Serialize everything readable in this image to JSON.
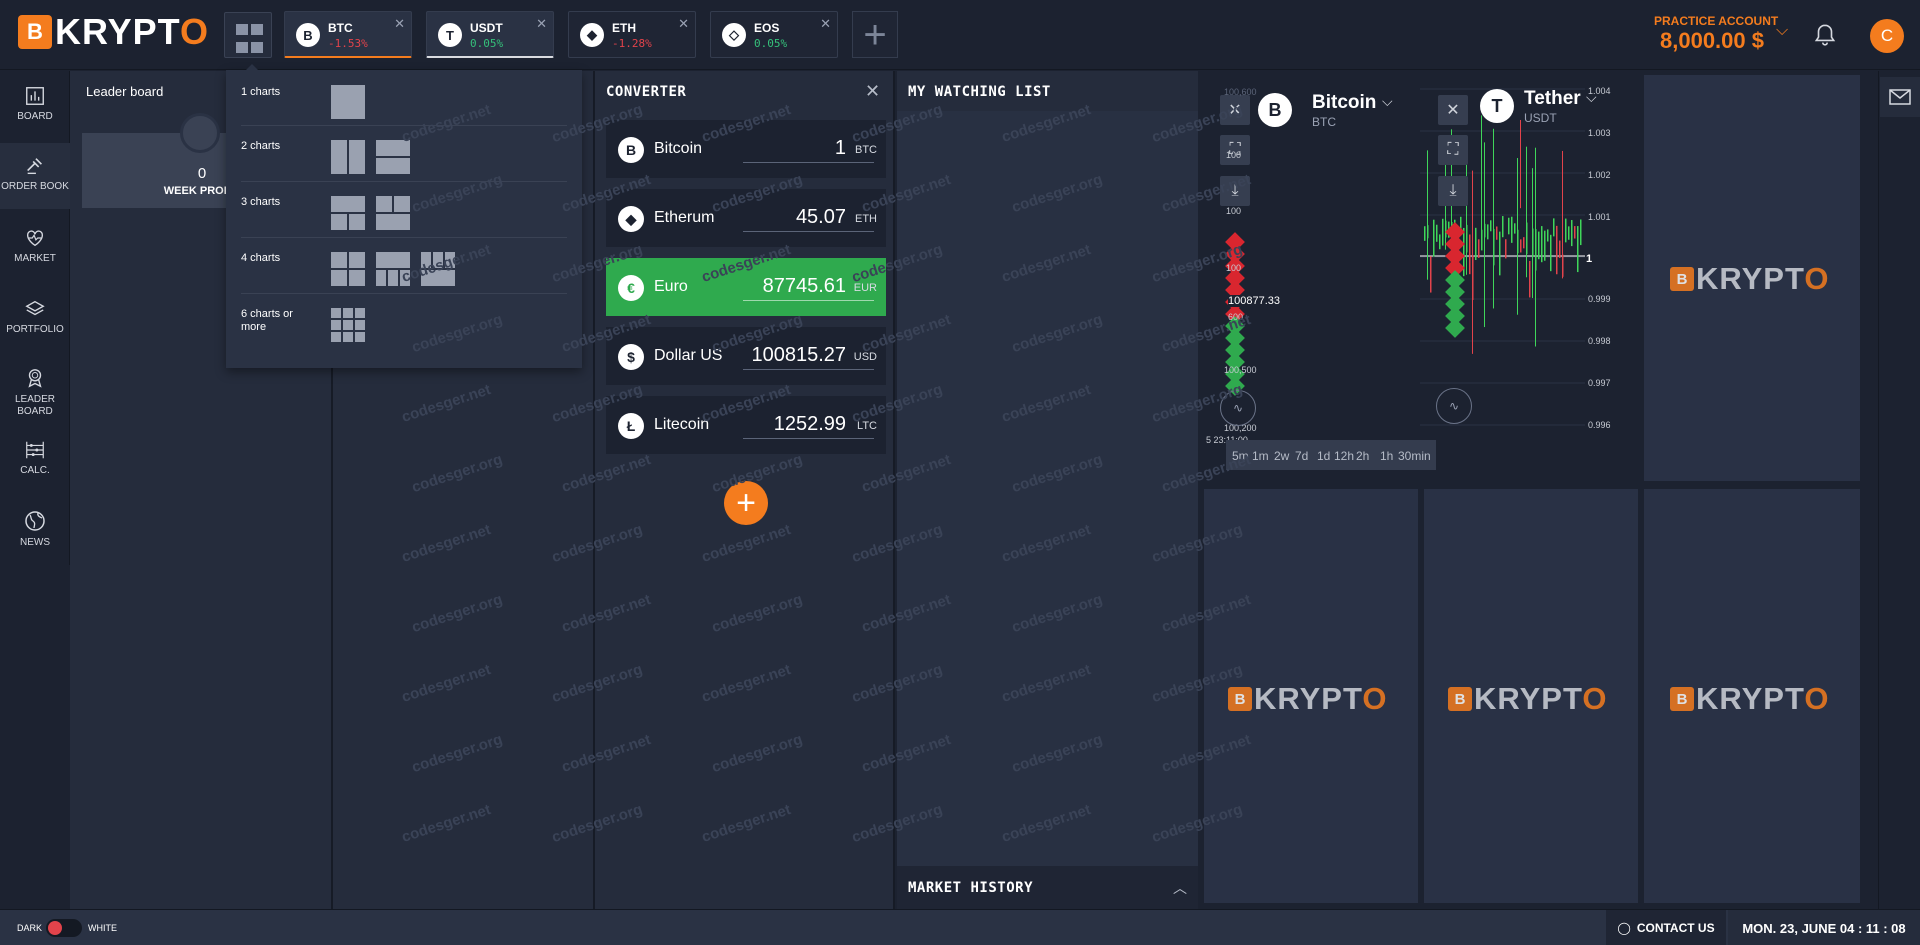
{
  "app": {
    "brand_initial": "B",
    "brand_name_main": "KRYPT",
    "brand_name_o": "O"
  },
  "tabs": [
    {
      "name": "BTC",
      "change": "-1.53%",
      "icon": "B",
      "trend": "neg"
    },
    {
      "name": "USDT",
      "change": "0.05%",
      "icon": "T",
      "trend": "pos"
    },
    {
      "name": "ETH",
      "change": "-1.28%",
      "icon": "◆",
      "trend": "neg"
    },
    {
      "name": "EOS",
      "change": "0.05%",
      "icon": "◇",
      "trend": "pos"
    }
  ],
  "account": {
    "label": "PRACTICE ACCOUNT",
    "balance": "8,000.00 $",
    "avatar": "C"
  },
  "sidebar": [
    {
      "label": "BOARD",
      "icon": "bar-chart-icon"
    },
    {
      "label": "ORDER BOOK",
      "icon": "gavel-icon"
    },
    {
      "label": "MARKET",
      "icon": "heart-pulse-icon"
    },
    {
      "label": "PORTFOLIO",
      "icon": "layers-icon"
    },
    {
      "label": "LEADER\nBOARD",
      "icon": "award-icon"
    },
    {
      "label": "CALC.",
      "icon": "abacus-icon"
    },
    {
      "label": "NEWS",
      "icon": "globe-icon"
    }
  ],
  "leaderboard": {
    "title": "Leader board",
    "value": "0",
    "label": "WEEK PROFIT"
  },
  "layout_menu": {
    "rows": [
      {
        "label": "1 charts"
      },
      {
        "label": "2 charts"
      },
      {
        "label": "3 charts"
      },
      {
        "label": "4 charts"
      },
      {
        "label": "6 charts or more"
      }
    ]
  },
  "converter": {
    "title": "CONVERTER",
    "rows": [
      {
        "name": "Bitcoin",
        "amount": "1",
        "currency": "BTC",
        "icon": "B"
      },
      {
        "name": "Etherum",
        "amount": "45.07",
        "currency": "ETH",
        "icon": "◆"
      },
      {
        "name": "Euro",
        "amount": "87745.61",
        "currency": "EUR",
        "icon": "€"
      },
      {
        "name": "Dollar US",
        "amount": "100815.27",
        "currency": "USD",
        "icon": "$"
      },
      {
        "name": "Litecoin",
        "amount": "1252.99",
        "currency": "LTC",
        "icon": "Ł"
      }
    ]
  },
  "watchlist": {
    "title": "MY WATCHING LIST",
    "market_history": "MARKET HISTORY"
  },
  "charts": {
    "bitcoin": {
      "name": "Bitcoin",
      "symbol": "BTC",
      "icon": "B",
      "price_label": "100877.33",
      "ticks": [
        "100,500",
        "100,200"
      ],
      "tick_partial": [
        "100,600",
        "100",
        "100",
        "600"
      ],
      "time": "5 23:11:00"
    },
    "tether": {
      "name": "Tether",
      "symbol": "USDT",
      "icon": "T",
      "ticks": [
        "1.004",
        "1.003",
        "1.002",
        "1.001",
        "1",
        "0.999",
        "0.998",
        "0.997",
        "0.996"
      ]
    },
    "timeframes": [
      "5m",
      "1m",
      "2w",
      "7d",
      "1d",
      "12h",
      "2h",
      "1h",
      "30min"
    ]
  },
  "watermark": {
    "texts": [
      "codesger.net",
      "codesger.org"
    ]
  },
  "footer": {
    "dark": "DARK",
    "white": "WHITE",
    "contact": "CONTACT US",
    "datetime": "MON. 23, JUNE 04 : 11 : 08"
  },
  "colors": {
    "accent": "#f47c1e",
    "negative": "#e2434b",
    "positive": "#35c07a",
    "highlight": "#2faa4e"
  }
}
